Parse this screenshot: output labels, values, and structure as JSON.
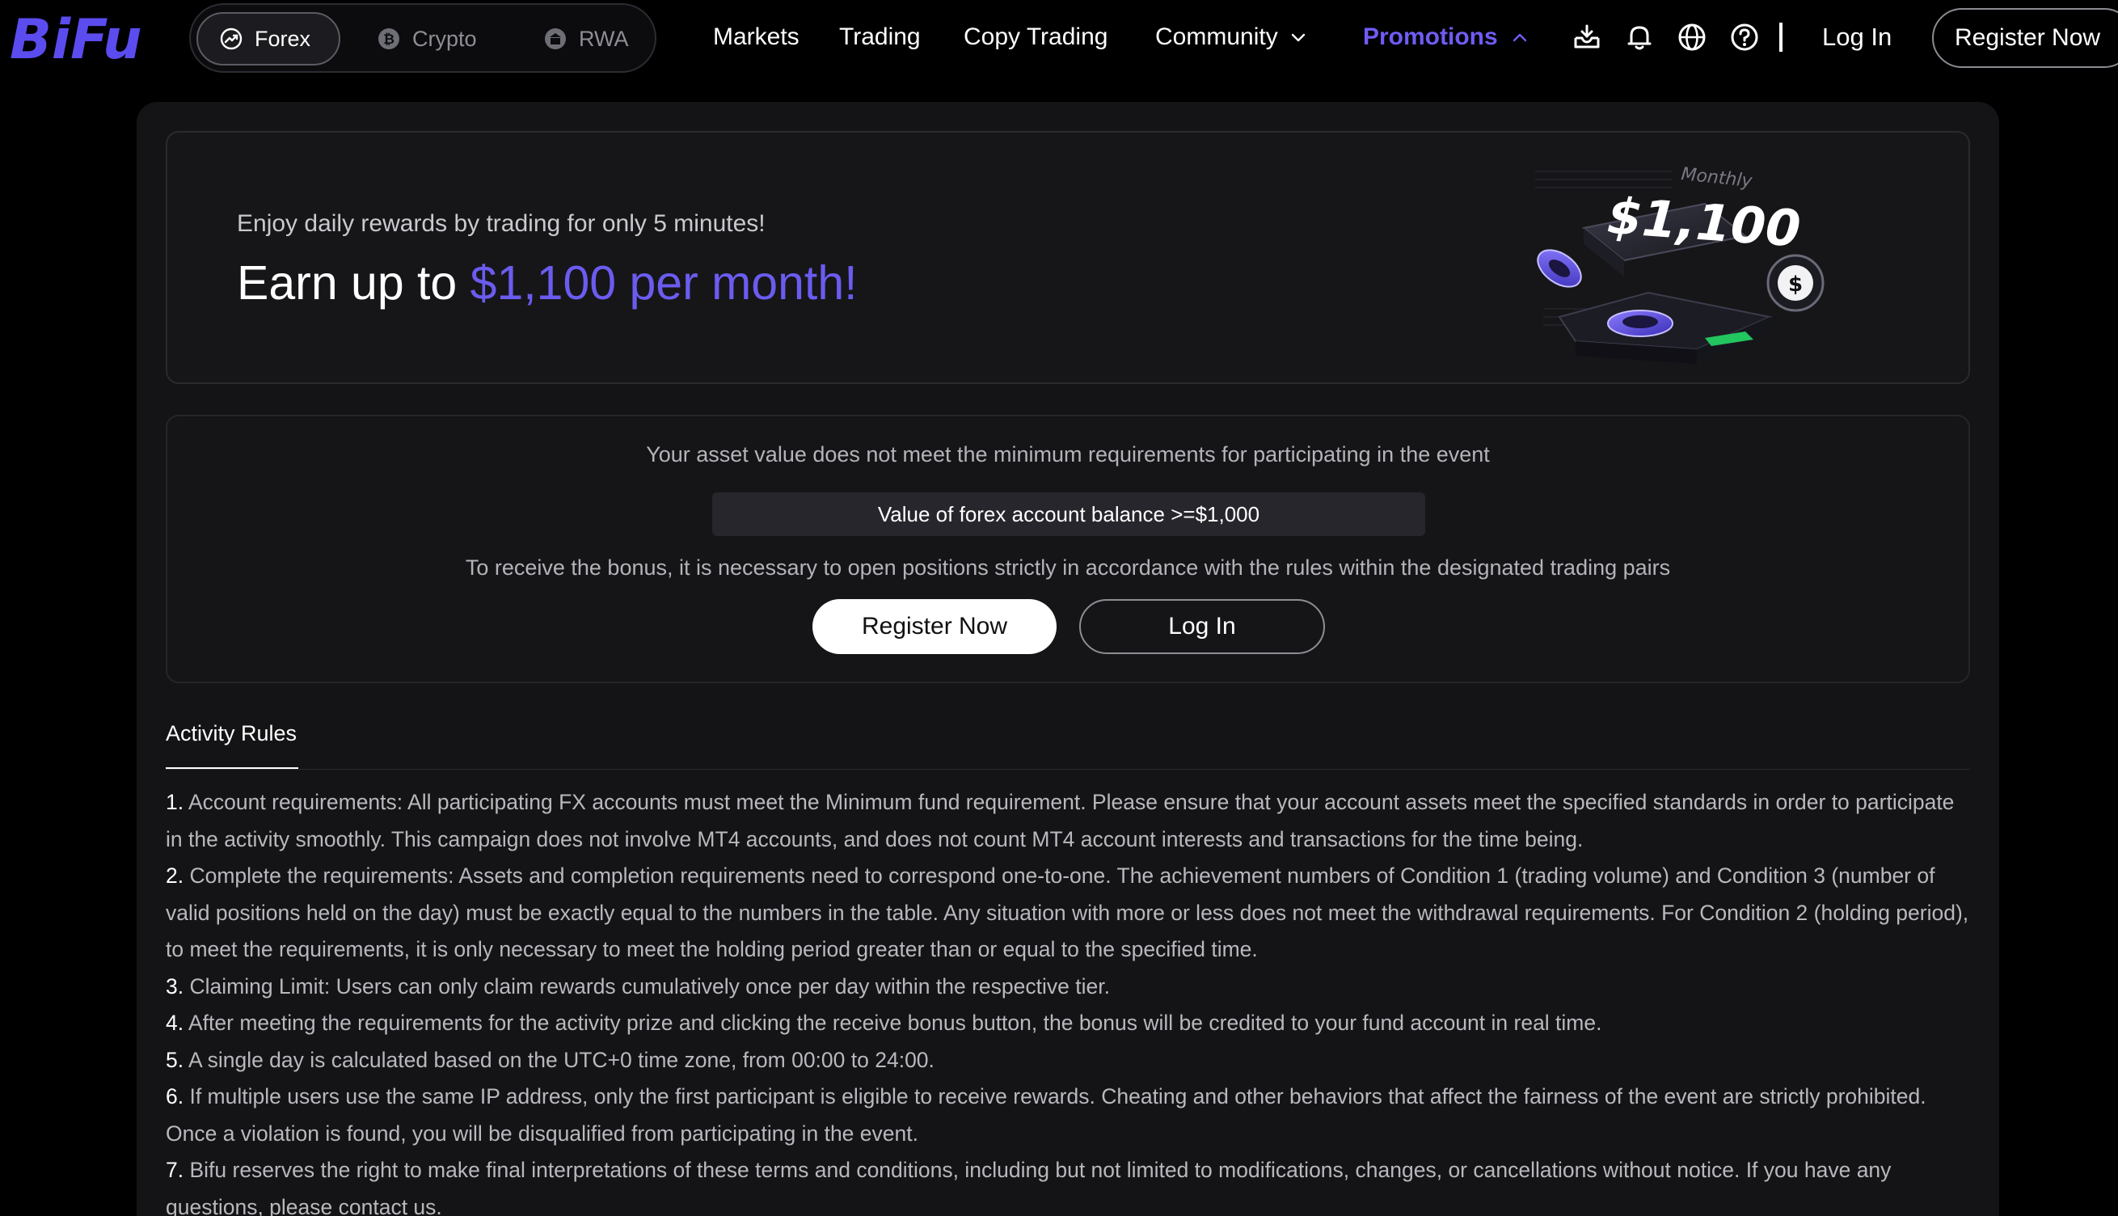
{
  "header": {
    "logo_text": "BiFu",
    "market_tabs": [
      {
        "label": "Forex",
        "icon": "chart-up-icon",
        "active": true
      },
      {
        "label": "Crypto",
        "icon": "bitcoin-icon",
        "active": false
      },
      {
        "label": "RWA",
        "icon": "building-icon",
        "active": false
      }
    ],
    "nav": {
      "markets": "Markets",
      "trading": "Trading",
      "copy_trading": "Copy Trading",
      "community": "Community",
      "promotions": "Promotions"
    },
    "icons": [
      "download-icon",
      "bell-icon",
      "globe-icon",
      "help-icon"
    ],
    "login": "Log In",
    "register": "Register Now"
  },
  "banner": {
    "subtitle": "Enjoy daily rewards by trading for only 5 minutes!",
    "title_prefix": "Earn up to ",
    "title_highlight": "$1,100 per month!",
    "art_label": "Monthly",
    "art_amount": "$1,100",
    "art_coin_symbol": "$"
  },
  "requirement": {
    "message": "Your asset value does not meet the minimum requirements for participating in the event",
    "condition": "Value of forex account balance >=$1,000",
    "note": "To receive the bonus, it is necessary to open positions strictly in accordance with the rules within the designated trading pairs",
    "register_button": "Register Now",
    "login_button": "Log In"
  },
  "rules": {
    "tab_label": "Activity Rules",
    "items": [
      {
        "num": "1.",
        "text": " Account requirements: All participating FX accounts must meet the Minimum fund requirement. Please ensure that your account assets meet the specified standards in order to participate in the activity smoothly. This campaign does not involve MT4 accounts, and does not count MT4 account interests and transactions for the time being."
      },
      {
        "num": "2.",
        "text": " Complete the requirements: Assets and completion requirements need to correspond one-to-one. The achievement numbers of Condition 1 (trading volume) and Condition 3 (number of valid positions held on the day) must be exactly equal to the numbers in the table. Any situation with more or less does not meet the withdrawal requirements. For Condition 2 (holding period), to meet the requirements, it is only necessary to meet the holding period greater than or equal to the specified time."
      },
      {
        "num": "3.",
        "text": " Claiming Limit: Users can only claim rewards cumulatively once per day within the respective tier."
      },
      {
        "num": "4.",
        "text": " After meeting the requirements for the activity prize and clicking the receive bonus button, the bonus will be credited to your fund account in real time."
      },
      {
        "num": "5.",
        "text": " A single day is calculated based on the UTC+0 time zone, from 00:00 to 24:00."
      },
      {
        "num": "6.",
        "text": " If multiple users use the same IP address, only the first participant is eligible to receive rewards. Cheating and other behaviors that affect the fairness of the event are strictly prohibited. Once a violation is found, you will be disqualified from participating in the event."
      },
      {
        "num": "7.",
        "text": " Bifu reserves the right to make final interpretations of these terms and conditions, including but not limited to modifications, changes, or cancellations without notice. If you have any questions, please contact us."
      }
    ]
  },
  "colors": {
    "accent": "#6b5cf0",
    "background": "#000000",
    "panel": "#141416"
  }
}
